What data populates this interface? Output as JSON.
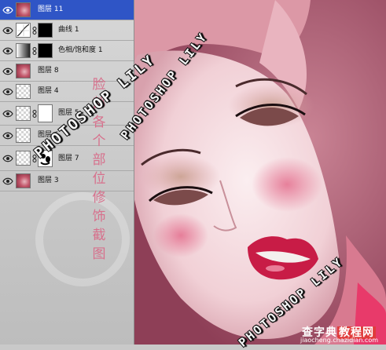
{
  "layers_panel": {
    "layers": [
      {
        "name": "图层 11",
        "thumb": "photo",
        "selected": true
      },
      {
        "name": "曲线 1",
        "thumb": "curves-adjustment",
        "mask": "black"
      },
      {
        "name": "色相/饱和度 1",
        "thumb": "hue-saturation-adjustment",
        "mask": "black"
      },
      {
        "name": "图层 8",
        "thumb": "photo"
      },
      {
        "name": "图层 4",
        "thumb": "transparent"
      },
      {
        "name": "图层 5",
        "thumb": "transparent",
        "mask": "white"
      },
      {
        "name": "图层 6",
        "thumb": "transparent"
      },
      {
        "name": "图层 7",
        "thumb": "transparent",
        "mask": "shape"
      },
      {
        "name": "图层 3",
        "thumb": "photo"
      }
    ]
  },
  "overlay": {
    "vertical_caption": [
      "脸",
      "部",
      "各",
      "个",
      "部",
      "位",
      "修",
      "饰",
      "截",
      "图"
    ],
    "watermark_center": "PHOTOSHOP LILY",
    "watermark_top": "PHOTOSHOP LILY",
    "watermark_bottom": "PHOTOSHOP LILY"
  },
  "site_logo": {
    "text_1": "查字典",
    "text_2": "教程网",
    "url": "jiaocheng.chazidian.com"
  },
  "colors": {
    "selection": "#2f55c6",
    "caption": "#d7708c",
    "photo_background": "#b86a80"
  }
}
